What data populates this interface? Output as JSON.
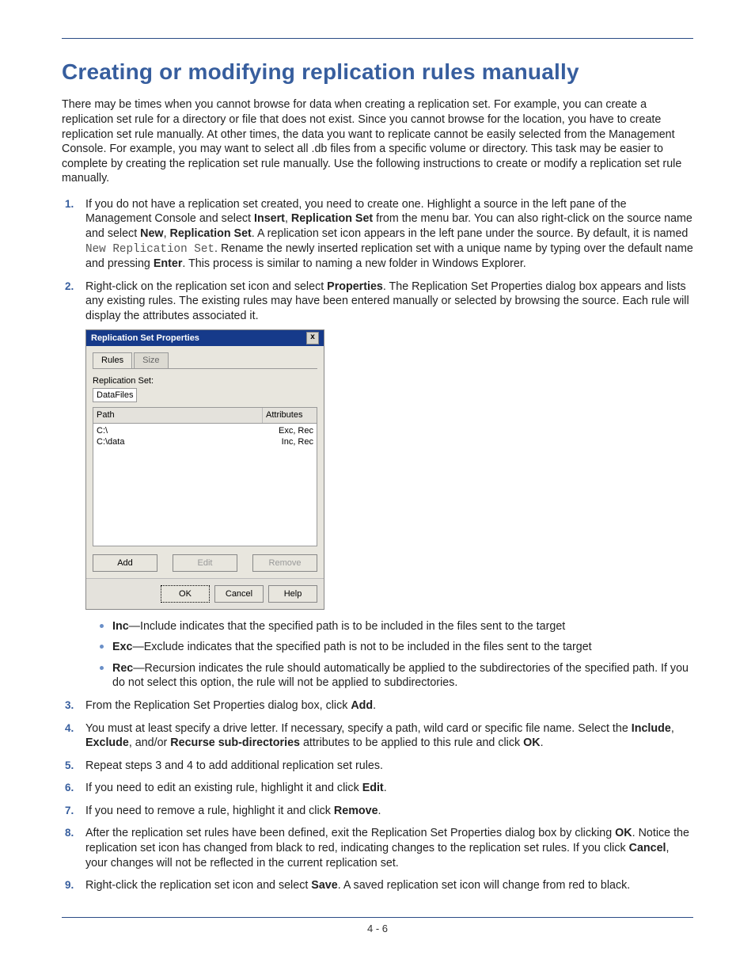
{
  "heading": "Creating or modifying replication rules manually",
  "intro": "There may be times when you cannot browse for data when creating a replication set. For example, you can create a replication set rule for a directory or file that does not exist. Since you cannot browse for the location, you have to create replication set rule manually. At other times, the data you want to replicate cannot be easily selected from the Management Console. For example, you may want to select all .db files from a specific volume or directory. This task may be easier to complete by creating the replication set rule manually. Use the following instructions to create or modify a replication set rule manually.",
  "step1": {
    "pre_insert": "If you do not have a replication set created, you need to create one. Highlight a source in the left pane of the Management Console and select ",
    "insert": "Insert",
    "comma1": ", ",
    "repset1": "Replication Set",
    "after_insert": " from the menu bar. You can also right-click on the source name and select ",
    "new": "New",
    "comma2": ", ",
    "repset2": "Replication Set",
    "after_new": ". A replication set icon appears in the left pane under the source. By default, it is named ",
    "mono": "New Replication Set",
    "after_mono": ". Rename the newly inserted replication set with a unique name by typing over the default name and pressing ",
    "enter": "Enter",
    "tail": ". This process is similar to naming a new folder in Windows Explorer."
  },
  "step2": {
    "pre": "Right-click on the replication set icon and select ",
    "props": "Properties",
    "post": ". The Replication Set Properties dialog box appears and lists any existing rules. The existing rules may have been entered manually or selected by browsing the source. Each rule will display the attributes associated it."
  },
  "dialog": {
    "title": "Replication Set Properties",
    "close": "x",
    "tab_rules": "Rules",
    "tab_size": "Size",
    "lbl_rs": "Replication Set:",
    "rs_value": "DataFiles",
    "col_path": "Path",
    "col_attr": "Attributes",
    "row1_path": "C:\\",
    "row1_attr": "Exc, Rec",
    "row2_path": "C:\\data",
    "row2_attr": "Inc, Rec",
    "btn_add": "Add",
    "btn_edit": "Edit",
    "btn_remove": "Remove",
    "btn_ok": "OK",
    "btn_cancel": "Cancel",
    "btn_help": "Help"
  },
  "defs": {
    "inc_b": "Inc",
    "inc_t": "—Include indicates that the specified path is to be included in the files sent to the target",
    "exc_b": "Exc",
    "exc_t": "—Exclude indicates that the specified path is not to be included in the files sent to the target",
    "rec_b": "Rec",
    "rec_t": "—Recursion indicates the rule should automatically be applied to the subdirectories of the specified path. If you do not select this option, the rule will not be applied to subdirectories."
  },
  "step3": {
    "pre": "From the Replication Set Properties dialog box, click ",
    "b": "Add",
    "post": "."
  },
  "step4": {
    "pre": "You must at least specify a drive letter. If necessary, specify a path, wild card or specific file name. Select the ",
    "b1": "Include",
    "c1": ", ",
    "b2": "Exclude",
    "c2": ", and/or ",
    "b3": "Recurse sub-directories",
    "mid": " attributes to be applied to this rule and click ",
    "b4": "OK",
    "post": "."
  },
  "step5": "Repeat steps 3 and 4 to add additional replication set rules.",
  "step6": {
    "pre": "If you need to edit an existing rule, highlight it and click ",
    "b": "Edit",
    "post": "."
  },
  "step7": {
    "pre": "If you need to remove a rule, highlight it and click ",
    "b": "Remove",
    "post": "."
  },
  "step8": {
    "pre": "After the replication set rules have been defined, exit the Replication Set Properties dialog box by clicking ",
    "b1": "OK",
    "mid": ". Notice the replication set icon has changed from black to red, indicating changes to the replication set rules. If you click ",
    "b2": "Cancel",
    "post": ", your changes will not be reflected in the current replication set."
  },
  "step9": {
    "pre": "Right-click the replication set icon and select ",
    "b": "Save",
    "post": ". A saved replication set icon will change from red to black."
  },
  "page_number": "4 - 6"
}
